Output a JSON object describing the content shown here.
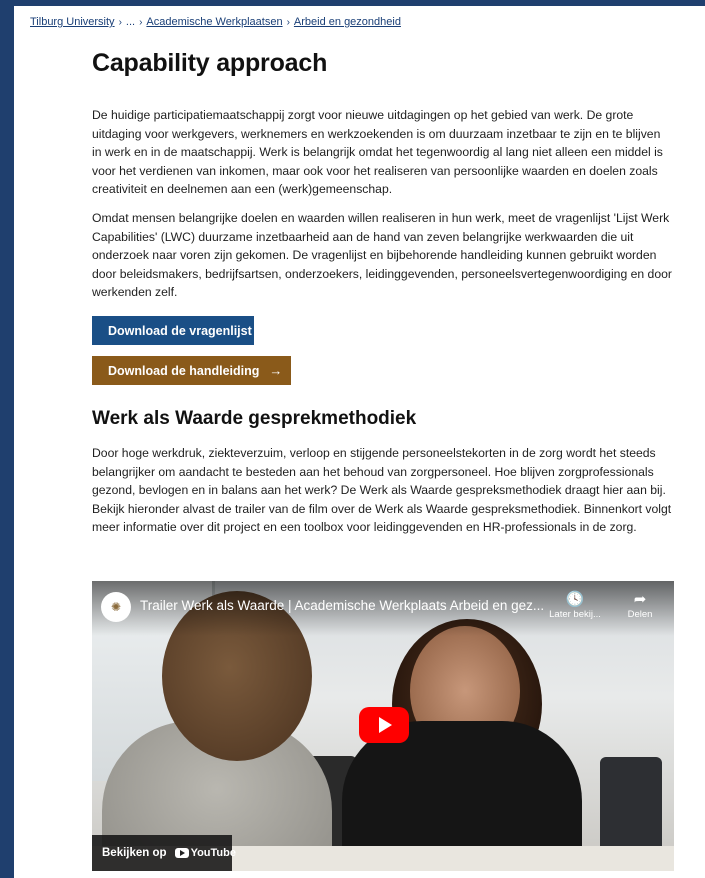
{
  "breadcrumb": {
    "items": [
      "Tilburg University",
      "...",
      "Academische Werkplaatsen",
      "Arbeid en gezondheid"
    ],
    "separator": "›"
  },
  "title": "Capability approach",
  "paragraphs": [
    "De huidige participatiemaatschappij zorgt voor nieuwe uitdagingen op het gebied van werk. De grote uitdaging voor werkgevers, werknemers en werkzoekenden is om duurzaam inzetbaar te zijn en te blijven in werk en in de maatschappij. Werk is belangrijk omdat het tegenwoordig al lang niet alleen een middel is voor het verdienen van inkomen, maar ook voor het realiseren van persoonlijke waarden en doelen zoals creativiteit en deelnemen aan een (werk)gemeenschap.",
    "Omdat mensen belangrijke doelen en waarden willen realiseren in hun werk, meet de vragenlijst 'Lijst Werk Capabilities' (LWC) duurzame inzetbaarheid aan de hand van zeven belangrijke werkwaarden die uit onderzoek naar voren zijn gekomen. De vragenlijst en bijbehorende handleiding kunnen gebruikt worden door beleidsmakers, bedrijfsartsen, onderzoekers, leidinggevenden, personeelsvertegenwoordiging en door werkenden zelf."
  ],
  "buttons": {
    "download_list": "Download de vragenlijst",
    "download_manual": "Download de handleiding",
    "arrow": "→"
  },
  "section2": {
    "heading": "Werk als Waarde gesprekmethodiek",
    "text": "Door hoge werkdruk, ziekteverzuim, verloop en stijgende personeelstekorten in de zorg wordt het steeds belangrijker om aandacht te besteden aan het behoud van zorgpersoneel. Hoe blijven zorgprofessionals gezond, bevlogen en in balans aan het werk? De Werk als Waarde gespreksmethodiek draagt hier aan bij. Bekijk hieronder alvast de trailer van de film over de Werk als Waarde gespreksmethodiek. Binnenkort volgt meer informatie over dit project en een toolbox voor leidinggevenden en HR-professionals in de zorg."
  },
  "video": {
    "title": "Trailer Werk als Waarde | Academische Werkplaats Arbeid en gez...",
    "watch_later": "Later bekij...",
    "share": "Delen",
    "watch_on": "Bekijken op",
    "youtube": "YouTube"
  },
  "colors": {
    "background": "#1f3f6e",
    "button_blue": "#1a4f86",
    "button_brown": "#8a5a1a",
    "link": "#1a3f77"
  }
}
